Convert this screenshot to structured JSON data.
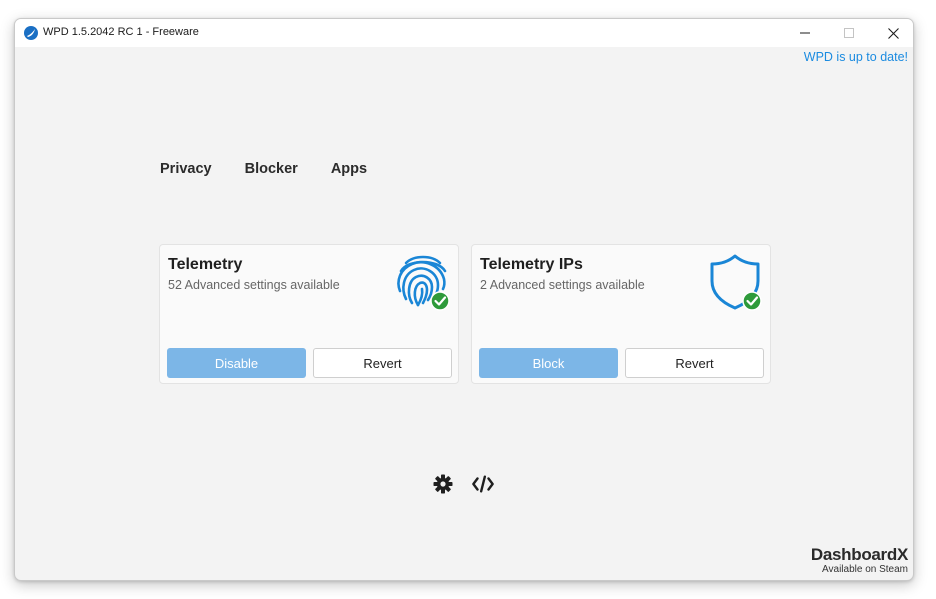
{
  "window": {
    "title": "WPD 1.5.2042 RC 1 - Freeware",
    "app_icon": "wpd-logo-icon",
    "controls": {
      "minimize_icon": "minimize-icon",
      "maximize_icon": "maximize-icon",
      "close_icon": "close-icon"
    }
  },
  "header": {
    "update_status": "WPD is up to date!"
  },
  "nav": {
    "tabs": [
      {
        "label": "Privacy"
      },
      {
        "label": "Blocker"
      },
      {
        "label": "Apps"
      }
    ]
  },
  "cards": [
    {
      "title": "Telemetry",
      "subtitle": "52 Advanced settings available",
      "icon": "fingerprint-icon",
      "status_icon": "check-badge-icon",
      "primary_button": "Disable",
      "secondary_button": "Revert"
    },
    {
      "title": "Telemetry IPs",
      "subtitle": "2 Advanced settings available",
      "icon": "shield-icon",
      "status_icon": "check-badge-icon",
      "primary_button": "Block",
      "secondary_button": "Revert"
    }
  ],
  "footer": {
    "settings_icon": "gear-icon",
    "code_icon": "code-icon"
  },
  "brand": {
    "name": "DashboardX",
    "tagline": "Available on Steam"
  },
  "colors": {
    "accent": "#1b8be0",
    "primary_button": "#7cb6e7",
    "success": "#2e9a3a",
    "icon_blue": "#1a86d6"
  }
}
